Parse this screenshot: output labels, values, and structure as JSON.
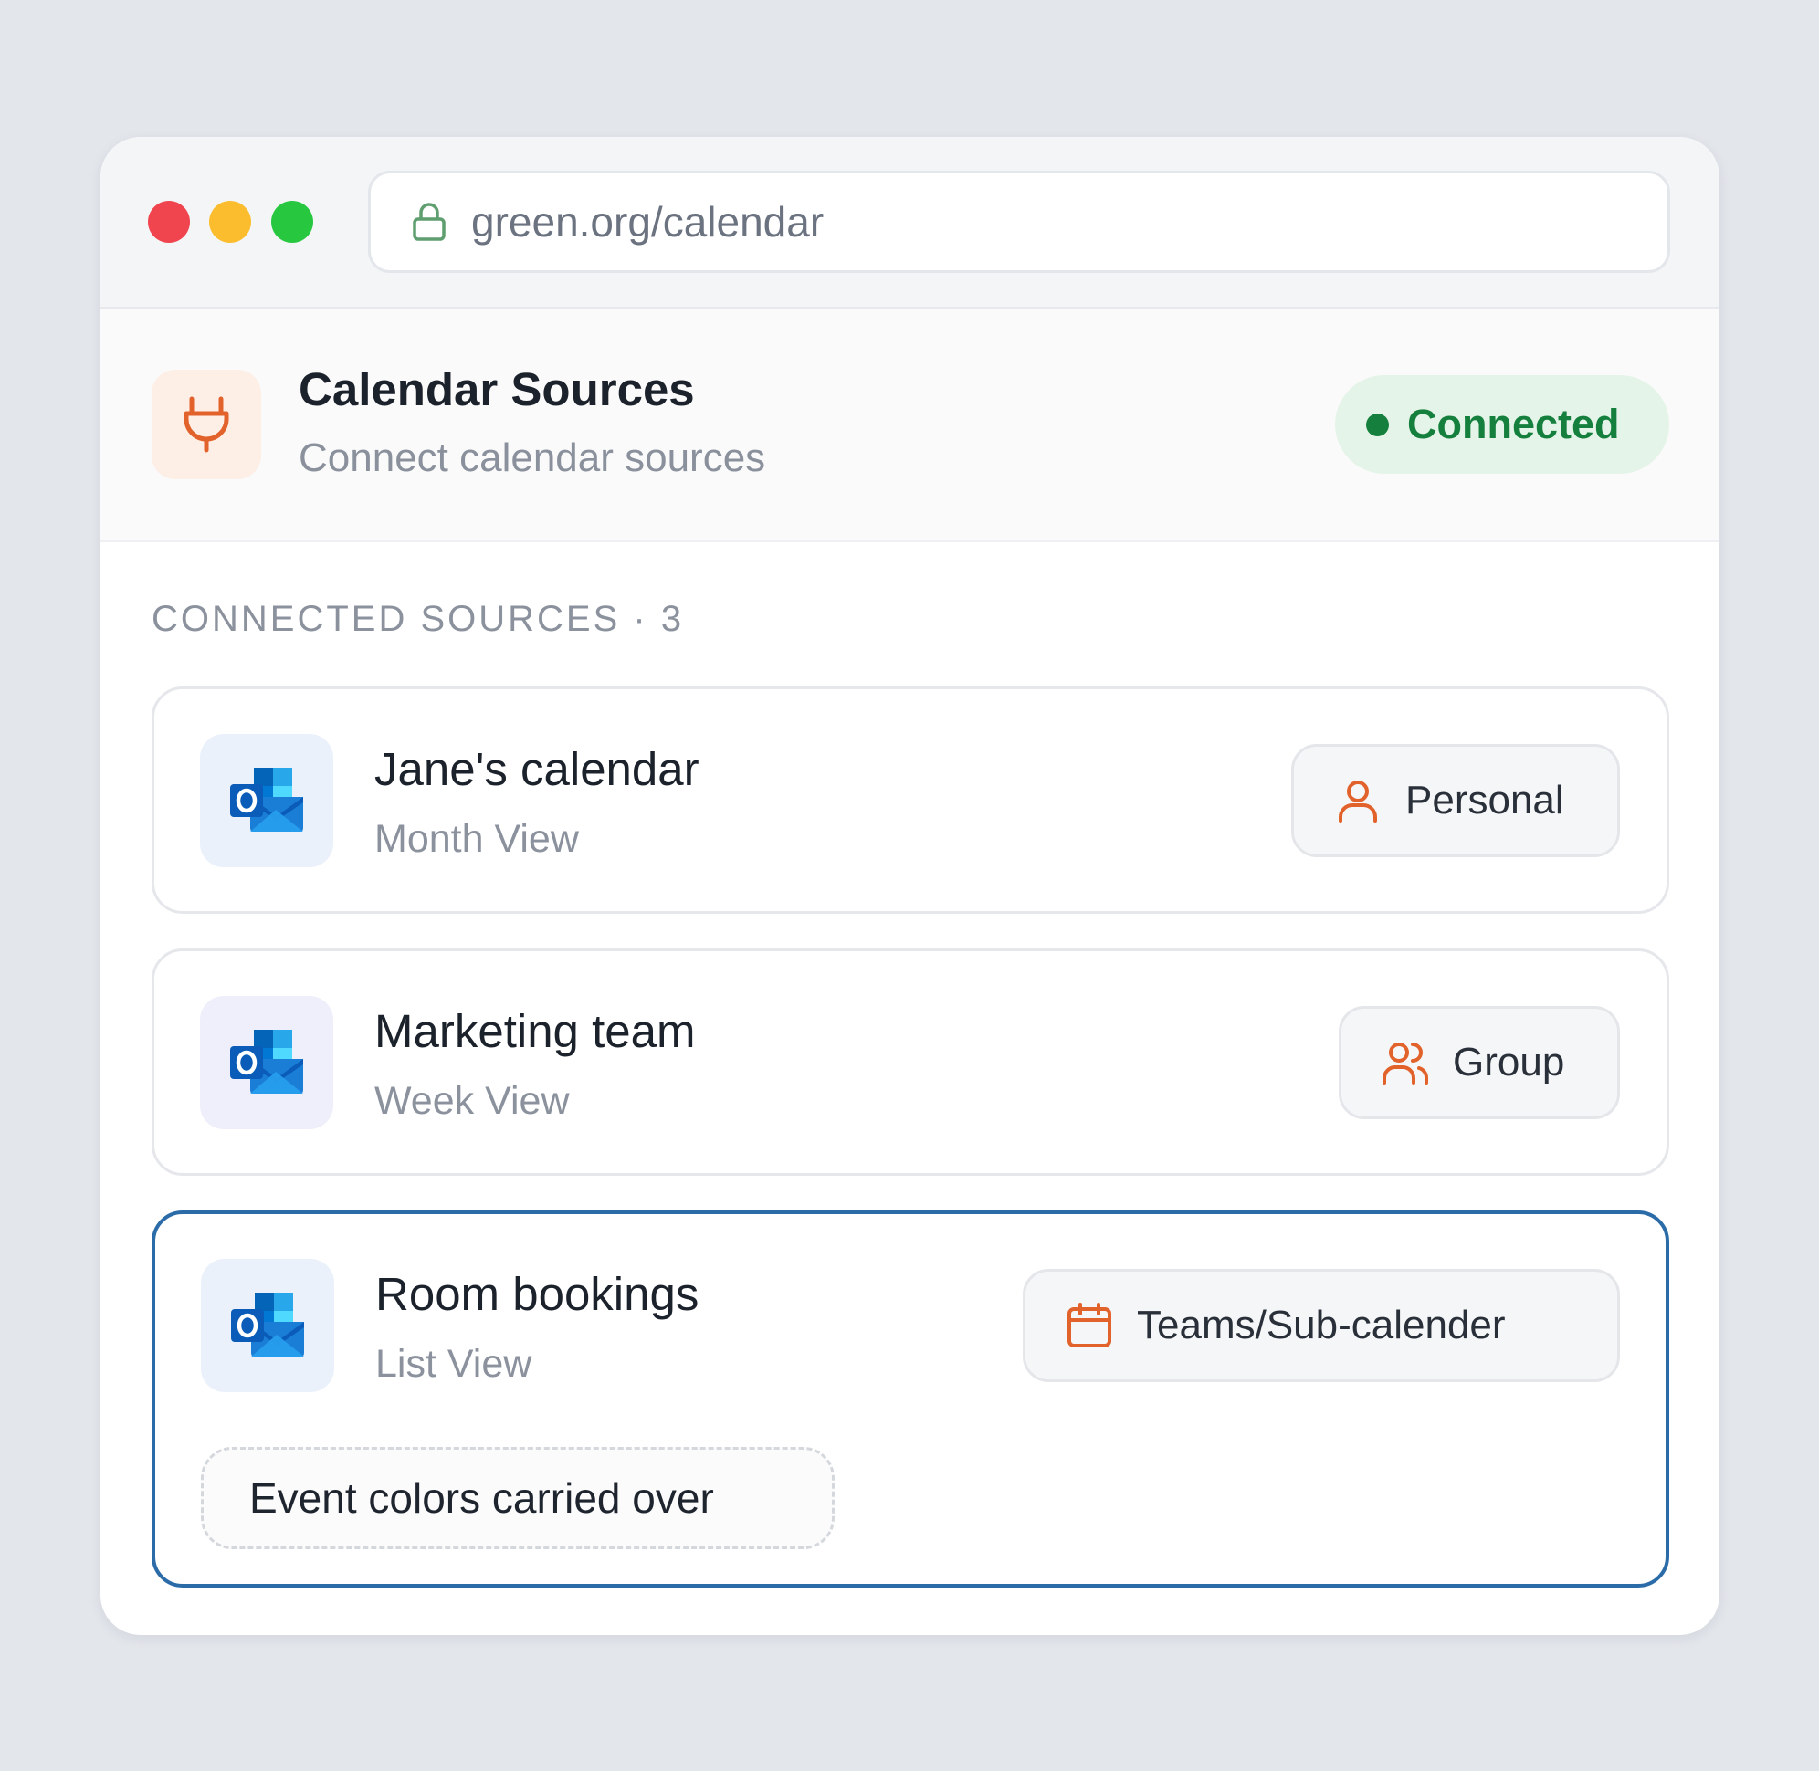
{
  "browser": {
    "url": "green.org/calendar"
  },
  "header": {
    "title": "Calendar Sources",
    "subtitle": "Connect calendar sources",
    "status": "Connected",
    "status_color": "#15803d",
    "icon": "plug-icon"
  },
  "sources": {
    "section_label": "CONNECTED SOURCES · 3",
    "items": [
      {
        "title": "Jane's calendar",
        "view": "Month View",
        "tag": "Personal",
        "tag_icon": "user-icon",
        "app_icon": "outlook-icon"
      },
      {
        "title": "Marketing team",
        "view": "Week View",
        "tag": "Group",
        "tag_icon": "users-icon",
        "app_icon": "outlook-icon"
      },
      {
        "title": "Room bookings",
        "view": "List View",
        "tag": "Teams/Sub-calender",
        "tag_icon": "calendar-icon",
        "app_icon": "outlook-icon",
        "note": "Event colors carried over"
      }
    ]
  },
  "colors": {
    "accent_orange": "#e2622b",
    "selected_border": "#2b6ca8",
    "outlook_blue": "#0a64c8"
  }
}
